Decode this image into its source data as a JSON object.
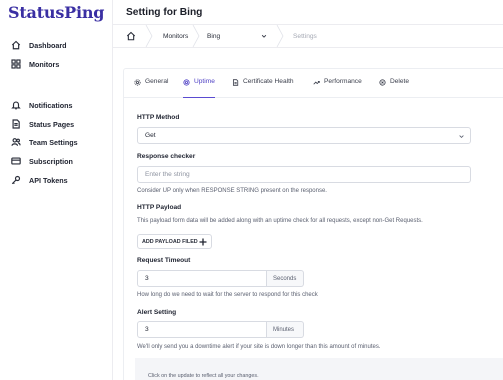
{
  "sidebar": {
    "logo": "StatusPing",
    "items": [
      {
        "label": "Dashboard",
        "icon": "home-icon"
      },
      {
        "label": "Monitors",
        "icon": "grid-icon"
      },
      {
        "label": "Notifications",
        "icon": "bell-icon"
      },
      {
        "label": "Status Pages",
        "icon": "document-icon"
      },
      {
        "label": "Team Settings",
        "icon": "users-icon"
      },
      {
        "label": "Subscription",
        "icon": "credit-card-icon"
      },
      {
        "label": "API Tokens",
        "icon": "key-icon"
      }
    ]
  },
  "header": {
    "title": "Setting for Bing"
  },
  "breadcrumb": {
    "home_icon": "home-icon",
    "items": [
      "Monitors",
      "Bing",
      "Settings"
    ]
  },
  "tabs": [
    {
      "label": "General",
      "icon": "gear-icon",
      "active": false
    },
    {
      "label": "Uptime",
      "icon": "target-icon",
      "active": true
    },
    {
      "label": "Certificate Health",
      "icon": "certificate-icon",
      "active": false
    },
    {
      "label": "Performance",
      "icon": "trend-icon",
      "active": false
    },
    {
      "label": "Delete",
      "icon": "x-circle-icon",
      "active": false
    }
  ],
  "form": {
    "http_method_label": "HTTP Method",
    "http_method_value": "Get",
    "response_checker_label": "Response checker",
    "response_checker_placeholder": "Enter the string",
    "response_checker_help": "Consider UP only when RESPONSE STRING present on the response.",
    "http_payload_label": "HTTP Payload",
    "http_payload_help": "This payload form data will be added along with an uptime check for all requests, except non-Get Requests.",
    "add_payload_button": "ADD PAYLOAD FILED",
    "request_timeout_label": "Request Timeout",
    "request_timeout_value": "3",
    "request_timeout_unit": "Seconds",
    "request_timeout_help": "How long do we need to wait for the server to respond for this check",
    "alert_setting_label": "Alert Setting",
    "alert_setting_value": "3",
    "alert_setting_unit": "Minutes",
    "alert_setting_help": "We'll only send you a downtime alert if your site is down longer than this amount of minutes."
  },
  "footer": {
    "text": "Click on the update to reflect all your changes."
  },
  "colors": {
    "accent": "#5a4bd1",
    "logo": "#3a2fa3",
    "text": "#1f2330",
    "muted": "#5b6070"
  }
}
